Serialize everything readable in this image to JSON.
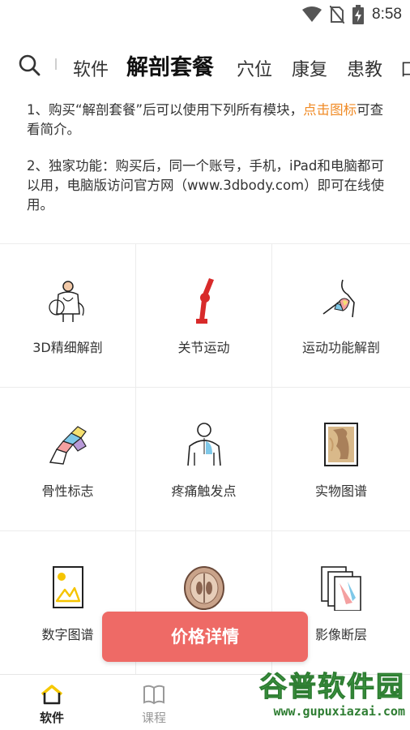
{
  "status_bar": {
    "time": "8:58",
    "icons": [
      "wifi-icon",
      "no-sim-icon",
      "battery-charging-icon"
    ]
  },
  "top_nav": {
    "tabs": [
      "软件",
      "解剖套餐",
      "穴位",
      "康复",
      "患教",
      "口"
    ],
    "active_tab": "解剖套餐",
    "highlight_color": "#f6d200"
  },
  "notes": {
    "line1_main": "1、购买“解剖套餐”后可以使用下列所有模块，",
    "line1_link": "点击图标",
    "line1_tail": "可查看简介。",
    "line2": "2、独家功能：购买后，同一个账号，手机，iPad和电脑都可以用，电脑版访问官方网（www.3dbody.com）即可在线使用。"
  },
  "modules": [
    {
      "label": "3D精细解剖",
      "icon": "3d-anatomy-icon"
    },
    {
      "label": "关节运动",
      "icon": "joint-motion-icon"
    },
    {
      "label": "运动功能解剖",
      "icon": "sport-anatomy-icon"
    },
    {
      "label": "骨性标志",
      "icon": "bone-landmark-icon"
    },
    {
      "label": "疼痛触发点",
      "icon": "pain-trigger-icon"
    },
    {
      "label": "实物图谱",
      "icon": "specimen-atlas-icon"
    },
    {
      "label": "数字图谱",
      "icon": "digital-atlas-icon"
    },
    {
      "label": "",
      "icon": "brain-section-icon"
    },
    {
      "label": "影像断层",
      "icon": "imaging-slice-icon"
    }
  ],
  "price_button": {
    "label": "价格详情",
    "color": "#ee6a66"
  },
  "bottom_bar": {
    "items": [
      {
        "label": "软件",
        "icon": "home-icon",
        "active": true
      },
      {
        "label": "课程",
        "icon": "book-icon",
        "active": false
      }
    ]
  },
  "watermark": {
    "title": "谷普软件园",
    "url": "www.gupuxiazai.com"
  }
}
